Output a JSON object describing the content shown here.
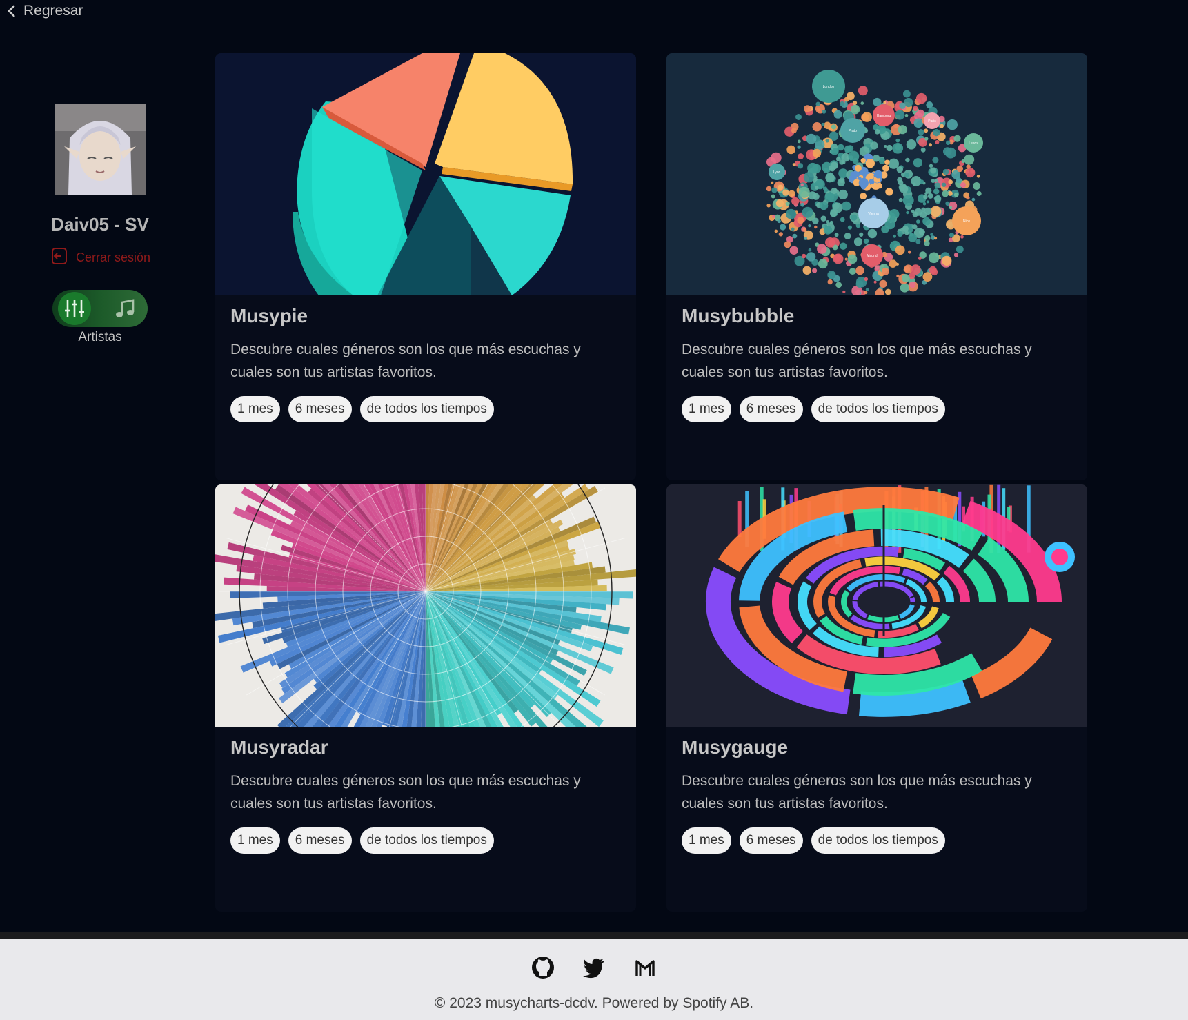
{
  "nav": {
    "back_label": "Regresar"
  },
  "profile": {
    "username": "Daiv05 - SV",
    "logout_label": "Cerrar sesión",
    "toggle_label": "Artistas",
    "toggle_state": "left"
  },
  "cards": [
    {
      "title": "Musypie",
      "description": "Descubre cuales géneros son los que más escuchas y cuales son tus artistas favoritos.",
      "ranges": [
        "1 mes",
        "6 meses",
        "de todos los tiempos"
      ]
    },
    {
      "title": "Musybubble",
      "description": "Descubre cuales géneros son los que más escuchas y cuales son tus artistas favoritos.",
      "ranges": [
        "1 mes",
        "6 meses",
        "de todos los tiempos"
      ]
    },
    {
      "title": "Musyradar",
      "description": "Descubre cuales géneros son los que más escuchas y cuales son tus artistas favoritos.",
      "ranges": [
        "1 mes",
        "6 meses",
        "de todos los tiempos"
      ]
    },
    {
      "title": "Musygauge",
      "description": "Descubre cuales géneros son los que más escuchas y cuales son tus artistas favoritos.",
      "ranges": [
        "1 mes",
        "6 meses",
        "de todos los tiempos"
      ]
    }
  ],
  "bubble_labels": [
    "London",
    "Hamburg",
    "Prato",
    "Paris",
    "Leeds",
    "Nice",
    "Vienna",
    "Madrid",
    "Lyon",
    "Berlin"
  ],
  "footer": {
    "copyright": "© 2023 musycharts-dcdv. Powered by Spotify AB.",
    "icons": [
      "github-icon",
      "twitter-icon",
      "gmail-icon"
    ]
  },
  "colors": {
    "background": "#030814",
    "card": "#070c1a",
    "toggle": "#1a7a2c",
    "logout": "#8f1a1a",
    "footer": "#e9e9ec"
  }
}
